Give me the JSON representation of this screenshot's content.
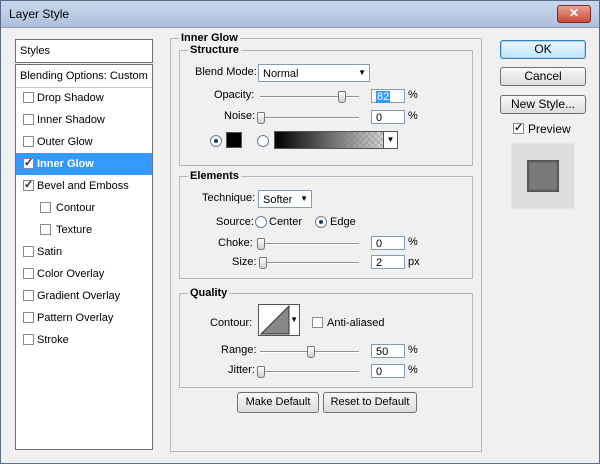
{
  "window": {
    "title": "Layer Style",
    "close_glyph": "✕"
  },
  "styles_header": "Styles",
  "styles_list": [
    {
      "label": "Blending Options: Custom",
      "type": "header"
    },
    {
      "label": "Drop Shadow",
      "checked": false
    },
    {
      "label": "Inner Shadow",
      "checked": false
    },
    {
      "label": "Outer Glow",
      "checked": false
    },
    {
      "label": "Inner Glow",
      "checked": true,
      "selected": true
    },
    {
      "label": "Bevel and Emboss",
      "checked": true
    },
    {
      "label": "Contour",
      "checked": false,
      "sub": true
    },
    {
      "label": "Texture",
      "checked": false,
      "sub": true
    },
    {
      "label": "Satin",
      "checked": false
    },
    {
      "label": "Color Overlay",
      "checked": false
    },
    {
      "label": "Gradient Overlay",
      "checked": false
    },
    {
      "label": "Pattern Overlay",
      "checked": false
    },
    {
      "label": "Stroke",
      "checked": false
    }
  ],
  "panel": {
    "title": "Inner Glow",
    "structure": {
      "title": "Structure",
      "blend_mode_label": "Blend Mode:",
      "blend_mode_value": "Normal",
      "opacity_label": "Opacity:",
      "opacity_value": "82",
      "opacity_unit": "%",
      "opacity_level": 0.82,
      "noise_label": "Noise:",
      "noise_value": "0",
      "noise_unit": "%",
      "noise_level": 0
    },
    "elements": {
      "title": "Elements",
      "technique_label": "Technique:",
      "technique_value": "Softer",
      "source_label": "Source:",
      "source_center": "Center",
      "source_edge": "Edge",
      "choke_label": "Choke:",
      "choke_value": "0",
      "choke_unit": "%",
      "choke_level": 0,
      "size_label": "Size:",
      "size_value": "2",
      "size_unit": "px",
      "size_level": 0.02
    },
    "quality": {
      "title": "Quality",
      "contour_label": "Contour:",
      "anti_aliased_label": "Anti-aliased",
      "range_label": "Range:",
      "range_value": "50",
      "range_unit": "%",
      "range_level": 0.5,
      "jitter_label": "Jitter:",
      "jitter_value": "0",
      "jitter_unit": "%",
      "jitter_level": 0
    },
    "make_default": "Make Default",
    "reset_default": "Reset to Default"
  },
  "actions": {
    "ok": "OK",
    "cancel": "Cancel",
    "new_style": "New Style...",
    "preview_label": "Preview",
    "preview_checked": true
  },
  "colors": {
    "selection": "#3399ff",
    "glow_swatch": "#000000"
  }
}
